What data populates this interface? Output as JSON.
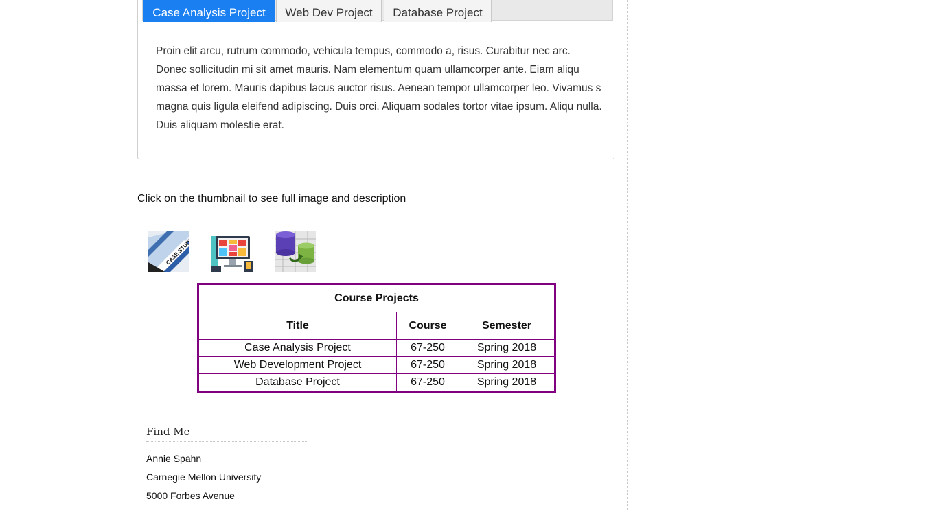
{
  "tabs": [
    {
      "label": "Case Analysis Project",
      "active": true
    },
    {
      "label": "Web Dev Project",
      "active": false
    },
    {
      "label": "Database Project",
      "active": false
    }
  ],
  "tab_content": "Proin elit arcu, rutrum commodo, vehicula tempus, commodo a, risus. Curabitur nec arc. Donec sollicitudin mi sit amet mauris. Nam elementum quam ullamcorper ante. Eiam aliqu massa et lorem. Mauris dapibus lacus auctor risus. Aenean tempor ullamcorper leo. Vivamus s magna quis ligula eleifend adipiscing. Duis orci. Aliquam sodales tortor vitae ipsum. Aliqu nulla. Duis aliquam molestie erat.",
  "instruction": "Click on the thumbnail to see full image and description",
  "thumbnails": [
    {
      "icon": "case-study-thumbnail",
      "label": "CASE STUDY"
    },
    {
      "icon": "web-dev-thumbnail"
    },
    {
      "icon": "database-thumbnail"
    }
  ],
  "table": {
    "caption": "Course Projects",
    "headers": [
      "Title",
      "Course",
      "Semester"
    ],
    "rows": [
      [
        "Case Analysis Project",
        "67-250",
        "Spring 2018"
      ],
      [
        "Web Development Project",
        "67-250",
        "Spring 2018"
      ],
      [
        "Database Project",
        "67-250",
        "Spring 2018"
      ]
    ],
    "border_color": "#800080"
  },
  "findme": {
    "title": "Find Me",
    "lines": [
      "Annie Spahn",
      "Carnegie Mellon University",
      "5000 Forbes Avenue"
    ]
  },
  "colors": {
    "active_tab": "#1a7ff0"
  }
}
